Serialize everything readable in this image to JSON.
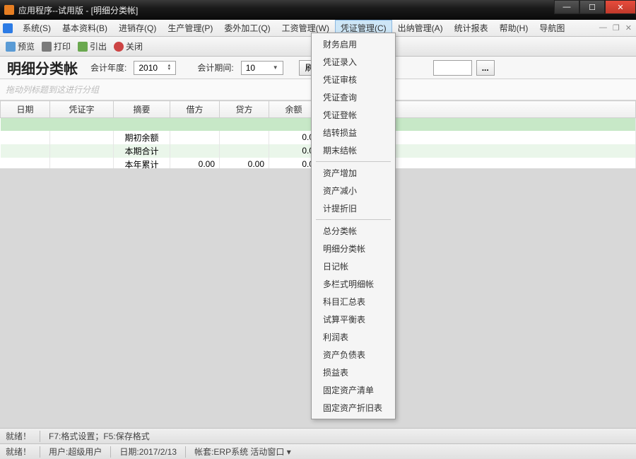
{
  "window": {
    "title": "应用程序--试用版 - [明细分类帐]"
  },
  "menubar": {
    "items": [
      "系统(S)",
      "基本资料(B)",
      "进销存(Q)",
      "生产管理(P)",
      "委外加工(Q)",
      "工资管理(W)",
      "凭证管理(C)",
      "出纳管理(A)",
      "统计报表",
      "帮助(H)",
      "导航图"
    ],
    "active_index": 6
  },
  "toolbar": {
    "preview": "预览",
    "print": "打印",
    "export": "引出",
    "close": "关闭"
  },
  "filter": {
    "page_title": "明细分类帐",
    "year_label": "会计年度:",
    "year_value": "2010",
    "period_label": "会计期间:",
    "period_value": "10",
    "refresh": "刷"
  },
  "group_hint": "拖动列标题到这进行分组",
  "columns": [
    "日期",
    "凭证字",
    "摘要",
    "借方",
    "贷方",
    "余额"
  ],
  "rows": [
    {
      "summary": "期初余额",
      "debit": "",
      "credit": "",
      "balance": "0.0"
    },
    {
      "summary": "本期合计",
      "debit": "",
      "credit": "",
      "balance": "0.0"
    },
    {
      "summary": "本年累计",
      "debit": "0.00",
      "credit": "0.00",
      "balance": "0.0"
    }
  ],
  "dropdown": {
    "groups": [
      [
        "财务启用",
        "凭证录入",
        "凭证审核",
        "凭证查询",
        "凭证登帐",
        "结转损益",
        "期末结帐"
      ],
      [
        "资产增加",
        "资产减小",
        "计提折旧"
      ],
      [
        "总分类帐",
        "明细分类帐",
        "日记帐",
        "多栏式明细帐",
        "科目汇总表",
        "试算平衡表",
        "利润表",
        "资产负债表",
        "损益表",
        "固定资产清单",
        "固定资产折旧表"
      ]
    ]
  },
  "status1": {
    "ready": "就绪！",
    "hint": "F7:格式设置；F5:保存格式"
  },
  "status2": {
    "ready": "就绪！",
    "user": "用户:超级用户",
    "date": "日期:2017/2/13",
    "db": "帐套:ERP系统  活动窗口 ▾"
  }
}
